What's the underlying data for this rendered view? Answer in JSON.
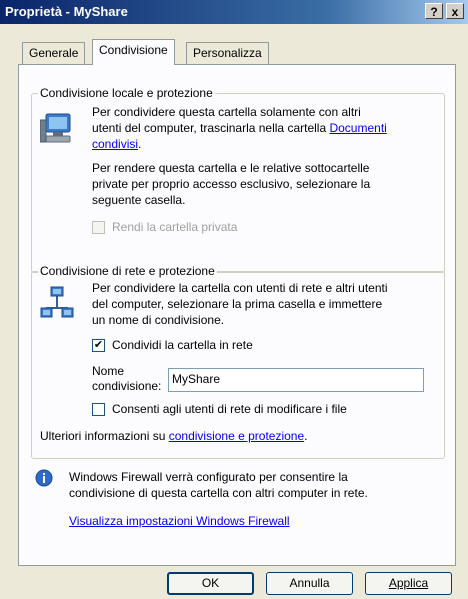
{
  "window": {
    "title": "Proprietà - MyShare",
    "help_label": "?",
    "close_label": "x"
  },
  "tabs": [
    {
      "label": "Generale"
    },
    {
      "label": "Condivisione"
    },
    {
      "label": "Personalizza"
    }
  ],
  "local_group": {
    "title": "Condivisione locale e protezione",
    "p1_l1": "Per condividere questa cartella solamente con altri",
    "p1_l2_a": "utenti del computer, trascinarla nella cartella ",
    "p1_link_a": "Documenti",
    "p1_link_b": "condivisi",
    "p1_end": ".",
    "p2_l1": "Per rendere questa cartella e le relative sottocartelle",
    "p2_l2": "private per proprio accesso esclusivo, selezionare la",
    "p2_l3": "seguente casella.",
    "private_checkbox_label": "Rendi la cartella privata"
  },
  "network_group": {
    "title": "Condivisione di rete e protezione",
    "p1_l1": "Per condividere la cartella con utenti di rete e altri utenti",
    "p1_l2": "del computer, selezionare la prima casella e immettere",
    "p1_l3": "un nome di condivisione.",
    "share_checkbox_label": "Condividi la cartella in rete",
    "share_checked": true,
    "share_name_label_1": "Nome",
    "share_name_label_2": "condivisione:",
    "share_name_value": "MyShare",
    "allow_change_label": "Consenti agli utenti di rete di modificare i file",
    "allow_change_checked": false,
    "more_info_prefix": "Ulteriori informazioni su ",
    "more_info_link": "condivisione e protezione",
    "more_info_suffix": "."
  },
  "firewall": {
    "line1": "Windows Firewall verrà configurato per consentire la",
    "line2": "condivisione di questa cartella con altri computer in rete.",
    "link": "Visualizza impostazioni Windows Firewall"
  },
  "buttons": {
    "ok": "OK",
    "cancel": "Annulla",
    "apply": "Applica"
  }
}
